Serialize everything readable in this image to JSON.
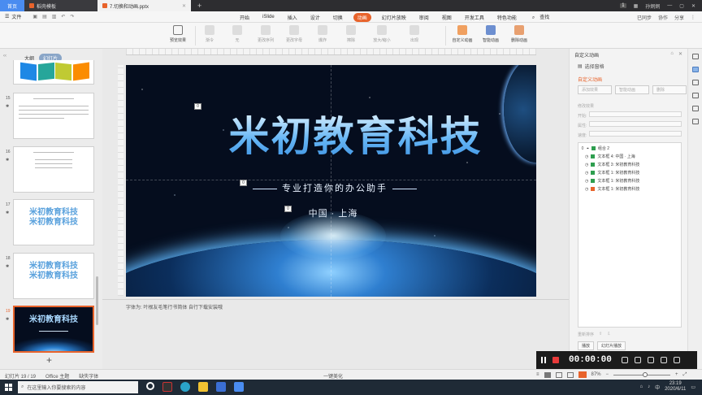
{
  "titlebar": {
    "tabs": [
      {
        "label": "首页"
      },
      {
        "label": "稻壳模板"
      },
      {
        "label": "7.切换和动画.pptx"
      }
    ],
    "new_tab": "+",
    "badge": "1",
    "user": "孙炯炯"
  },
  "menubar": {
    "file_label": "文件",
    "tabs": [
      "开始",
      "iSlide",
      "插入",
      "设计",
      "切换",
      "动画",
      "幻灯片放映",
      "审阅",
      "视图",
      "开发工具",
      "特色功能"
    ],
    "active_tab": "动画",
    "search": "查找",
    "sync": "已同步",
    "collab": "协作",
    "share": "分享"
  },
  "ribbon": {
    "buttons": [
      "预览效果",
      "渐令",
      "无",
      "更改序列",
      "更改字母",
      "爆炸",
      "擦除",
      "放大/缩小",
      "出现"
    ],
    "right_buttons": [
      "自定义动画",
      "智能动画",
      "删除动画"
    ]
  },
  "left_panel": {
    "tabs": [
      "大纲",
      "幻灯片"
    ],
    "active_tab": "幻灯片",
    "add": "+",
    "slides": [
      {
        "num": "15"
      },
      {
        "num": "16"
      },
      {
        "num": "17",
        "title": "米初教育科技"
      },
      {
        "num": "18",
        "title": "米初教育科技"
      },
      {
        "num": "19",
        "title": "米初教育科技"
      }
    ]
  },
  "slide": {
    "title": "米初教育科技",
    "subtitle": "专业打造你的办公助手",
    "location": "中国 · 上海",
    "tags": [
      "0",
      "0",
      "0"
    ]
  },
  "notes": {
    "text": "字体为: 叶根友毛笔行书简体  自行下载安装哦"
  },
  "right_panel": {
    "header": "自定义动画",
    "select_pane": "选择窗格",
    "section": "自定义动画",
    "add_effect": "添加效果",
    "smart_anim": "智能动画",
    "delete": "删除",
    "modify_label": "修改效果",
    "start_label": "开始:",
    "prop_label": "属性:",
    "speed_label": "速度:",
    "list": [
      {
        "n": "0",
        "text": "组合 2",
        "color": "#2e9e4f"
      },
      {
        "n": "",
        "text": "文本框 4: 中国 · 上海",
        "color": "#2e9e4f"
      },
      {
        "n": "",
        "text": "文本框 3: 米初教育科技",
        "color": "#2e9e4f"
      },
      {
        "n": "",
        "text": "文本框 1: 米初教育科技",
        "color": "#2e9e4f"
      },
      {
        "n": "",
        "text": "文本框 1: 米初教育科技",
        "color": "#2e9e4f"
      },
      {
        "n": "",
        "text": "文本框 1: 米初教育科技",
        "color": "#e8632b"
      }
    ],
    "reorder": "重新排序",
    "play": "播放",
    "slideshow": "幻灯片播放"
  },
  "recorder": {
    "time": "00:00:00"
  },
  "statusbar": {
    "slide_info": "幻灯片 19 / 19",
    "theme": "Office 主题",
    "font_missing": "缺失字体",
    "beautify": "一键美化",
    "zoom": "87%",
    "zoom_minus": "−",
    "zoom_plus": "+"
  },
  "taskbar": {
    "search_placeholder": "在这里输入你要搜索的内容",
    "time": "23:19",
    "date": "2020/6/11"
  }
}
